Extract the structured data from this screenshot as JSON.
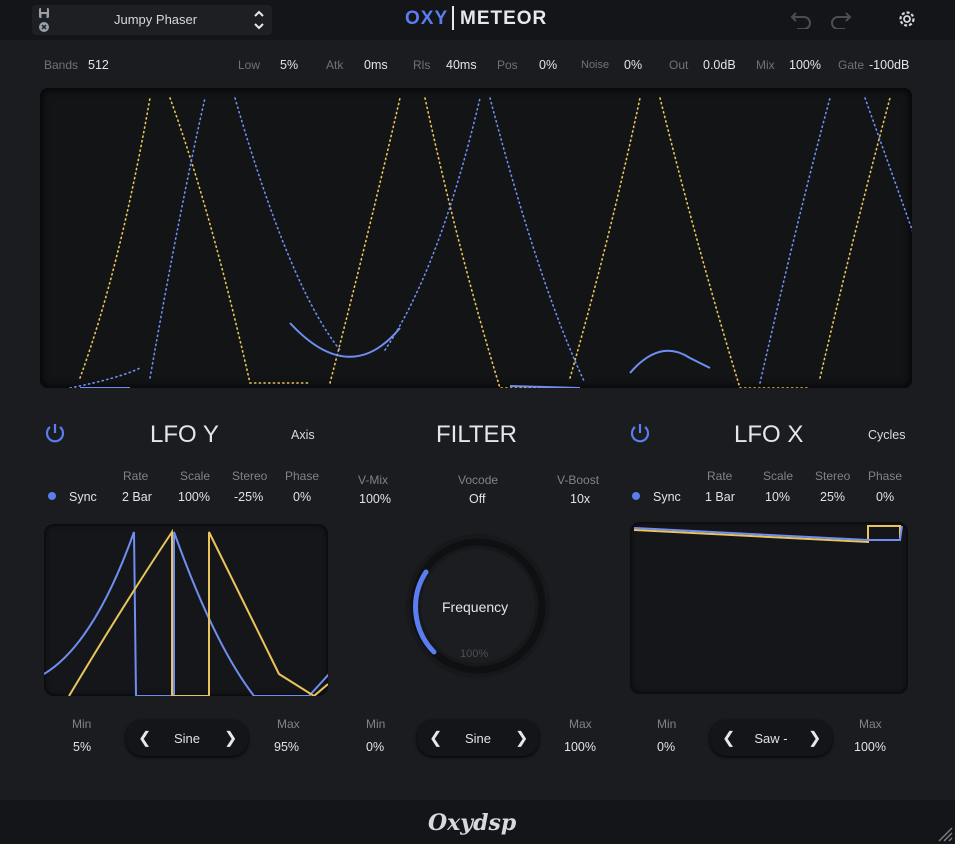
{
  "header": {
    "preset_name": "Jumpy Phaser",
    "logo_left": "OXY",
    "logo_right": "METEOR"
  },
  "params": {
    "bands_label": "Bands",
    "bands_value": "512",
    "low_label": "Low",
    "low_value": "5%",
    "atk_label": "Atk",
    "atk_value": "0ms",
    "rls_label": "Rls",
    "rls_value": "40ms",
    "pos_label": "Pos",
    "pos_value": "0%",
    "noise_label": "Noise",
    "noise_value": "0%",
    "out_label": "Out",
    "out_value": "0.0dB",
    "mix_label": "Mix",
    "mix_value": "100%",
    "gate_label": "Gate",
    "gate_value": "-100dB"
  },
  "lfo_y": {
    "title": "LFO Y",
    "tag": "Axis",
    "sync_label": "Sync",
    "rate_label": "Rate",
    "rate_value": "2 Bar",
    "scale_label": "Scale",
    "scale_value": "100%",
    "stereo_label": "Stereo",
    "stereo_value": "-25%",
    "phase_label": "Phase",
    "phase_value": "0%",
    "min_label": "Min",
    "min_value": "5%",
    "max_label": "Max",
    "max_value": "95%",
    "shape": "Sine"
  },
  "filter": {
    "title": "FILTER",
    "vmix_label": "V-Mix",
    "vmix_value": "100%",
    "vocode_label": "Vocode",
    "vocode_value": "Off",
    "vboost_label": "V-Boost",
    "vboost_value": "10x",
    "knob_label": "Frequency",
    "knob_value": "100%",
    "min_label": "Min",
    "min_value": "0%",
    "max_label": "Max",
    "max_value": "100%",
    "shape": "Sine"
  },
  "lfo_x": {
    "title": "LFO X",
    "tag": "Cycles",
    "sync_label": "Sync",
    "rate_label": "Rate",
    "rate_value": "1 Bar",
    "scale_label": "Scale",
    "scale_value": "10%",
    "stereo_label": "Stereo",
    "stereo_value": "25%",
    "phase_label": "Phase",
    "phase_value": "0%",
    "min_label": "Min",
    "min_value": "0%",
    "max_label": "Max",
    "max_value": "100%",
    "shape": "Saw -"
  },
  "footer": {
    "brand": "Oxydsp"
  },
  "colors": {
    "accent": "#5a7df0",
    "yellow": "#e8c45a",
    "blue": "#6f8ef0"
  },
  "icons": [
    "save-icon",
    "close-icon",
    "updown-chevron-icon",
    "undo-icon",
    "redo-icon",
    "gear-icon",
    "power-icon",
    "chevron-left-icon",
    "chevron-right-icon",
    "resize-icon"
  ]
}
